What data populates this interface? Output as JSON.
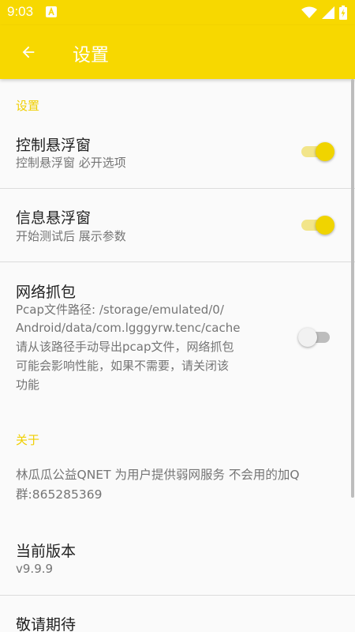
{
  "status_bar": {
    "time": "9:03"
  },
  "app_bar": {
    "title": "设置"
  },
  "sections": {
    "settings": {
      "label": "设置",
      "items": [
        {
          "title": "控制悬浮窗",
          "summary": "控制悬浮窗 必开选项",
          "enabled": true
        },
        {
          "title": "信息悬浮窗",
          "summary": "开始测试后 展示参数",
          "enabled": true
        },
        {
          "title": "网络抓包",
          "summary_lines": [
            "Pcap文件路径: /storage/emulated/0/",
            "Android/data/com.lgggyrw.tenc/cache",
            "请从该路径手动导出pcap文件，网络抓包",
            "可能会影响性能，如果不需要，请关闭该",
            "功能"
          ],
          "enabled": false
        }
      ]
    },
    "about": {
      "label": "关于",
      "description_lines": [
        "林瓜瓜公益QNET 为用户提供弱网服务 不会用的加Q",
        "群:865285369"
      ],
      "version_title": "当前版本",
      "version_value": "v9.9.9",
      "coming_soon": "敬请期待"
    }
  },
  "colors": {
    "primary": "#f7d800",
    "accent": "#f0d400",
    "text_primary": "#212121",
    "text_secondary": "#757575"
  }
}
